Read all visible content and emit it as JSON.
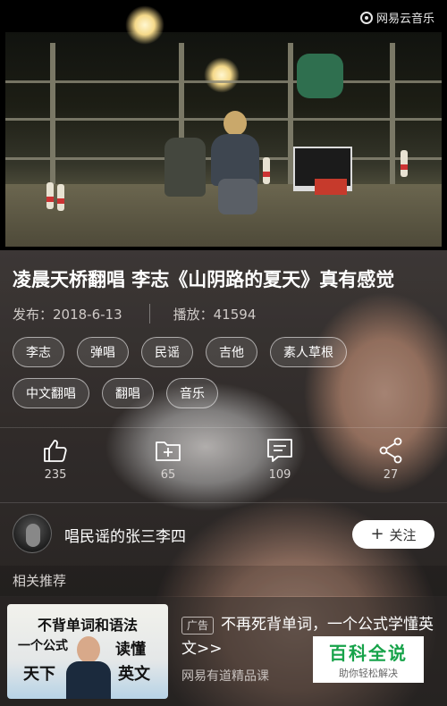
{
  "video": {
    "watermark": "网易云音乐"
  },
  "title": "凌晨天桥翻唱 李志《山阴路的夏天》真有感觉",
  "meta": {
    "publish": "发布：2018-6-13",
    "plays": "播放：41594"
  },
  "tags_row1": [
    "李志",
    "弹唱",
    "民谣",
    "吉他",
    "素人草根"
  ],
  "tags_row2": [
    "中文翻唱",
    "翻唱",
    "音乐"
  ],
  "actions": {
    "like_count": "235",
    "collect_count": "65",
    "comment_count": "109",
    "share_count": "27"
  },
  "author": {
    "name": "唱民谣的张三李四",
    "follow_label": "关注",
    "follow_plus": "+"
  },
  "related_label": "相关推荐",
  "ad": {
    "badge": "广告",
    "title": "不再死背单词，一个公式学懂英文>>",
    "source": "网易有道精品课",
    "thumb_line1": "不背单词和语法",
    "thumb_line2_left": "一个公式",
    "thumb_line2_right": "读懂",
    "thumb_line3_left": "天下",
    "thumb_line3_right": "英文"
  },
  "baike": {
    "name": "百科全说",
    "slogan": "助你轻松解决"
  }
}
